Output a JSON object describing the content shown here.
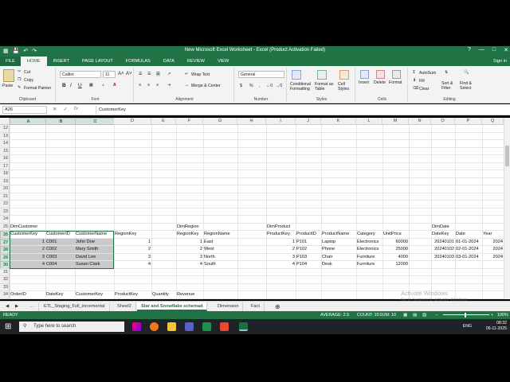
{
  "window": {
    "title": "New Microsoft Excel Worksheet - Excel (Product Activation Failed)",
    "minimize": "—",
    "maximize": "□",
    "close": "✕",
    "restore_ribbon": "?"
  },
  "tabs": [
    {
      "label": "FILE"
    },
    {
      "label": "HOME"
    },
    {
      "label": "INSERT"
    },
    {
      "label": "PAGE LAYOUT"
    },
    {
      "label": "FORMULAS"
    },
    {
      "label": "DATA"
    },
    {
      "label": "REVIEW"
    },
    {
      "label": "VIEW"
    }
  ],
  "sign_in": "Sign in",
  "ribbon": {
    "clipboard": {
      "paste": "Paste",
      "cut": "Cut",
      "copy": "Copy",
      "painter": "Format Painter",
      "label": "Clipboard"
    },
    "font": {
      "name": "Calibri",
      "size": "11",
      "label": "Font",
      "bold": "B",
      "italic": "I",
      "underline": "U"
    },
    "alignment": {
      "wrap": "Wrap Text",
      "merge": "Merge & Center",
      "label": "Alignment"
    },
    "number": {
      "format": "General",
      "label": "Number",
      "currency": "$",
      "percent": "%"
    },
    "styles": {
      "conditional": "Conditional Formatting",
      "table": "Format as Table",
      "cell": "Cell Styles",
      "label": "Styles"
    },
    "cells": {
      "insert": "Insert",
      "delete": "Delete",
      "format": "Format",
      "label": "Cells"
    },
    "editing": {
      "autosum": "AutoSum",
      "fill": "Fill",
      "clear": "Clear",
      "sort": "Sort & Filter",
      "find": "Find & Select",
      "label": "Editing"
    }
  },
  "formula_bar": {
    "name_box": "A26",
    "formula": "CustomerKey"
  },
  "columns": [
    "A",
    "B",
    "C",
    "D",
    "E",
    "F",
    "G",
    "H",
    "I",
    "J",
    "K",
    "L",
    "M",
    "N",
    "O",
    "P",
    "Q"
  ],
  "rows": [
    "12",
    "13",
    "14",
    "15",
    "16",
    "17",
    "18",
    "19",
    "20",
    "21",
    "22",
    "23",
    "24",
    "25",
    "26",
    "27",
    "28",
    "29",
    "30",
    "31",
    "32",
    "33",
    "34",
    "35"
  ],
  "cells": {
    "r25": {
      "A": "DimCustomer",
      "F": "DimRegion",
      "I": "DimProduct",
      "O": "DimDate"
    },
    "r26": {
      "A": "CustomerKey",
      "B": "CustomerID",
      "C": "CustomerName",
      "D": "RegionKey",
      "F": "RegionKey",
      "G": "RegionName",
      "I": "ProductKey",
      "J": "ProductID",
      "K": "ProductName",
      "L": "Category",
      "M": "UnitPrice",
      "O": "DateKey",
      "P": "Date",
      "Q": "Year",
      "R": "Mo"
    },
    "r27": {
      "A": "1",
      "B": "C001",
      "C": "John Doe",
      "D": "1",
      "F": "1",
      "G": "East",
      "I": "1",
      "J": "P101",
      "K": "Laptop",
      "L": "Electronics",
      "M": "60000",
      "O": "20240101",
      "P": "01-01-2024",
      "Q": "2024"
    },
    "r28": {
      "A": "2",
      "B": "C002",
      "C": "Mary Smith",
      "D": "2",
      "F": "2",
      "G": "West",
      "I": "2",
      "J": "P102",
      "K": "Phone",
      "L": "Electronics",
      "M": "25000",
      "O": "20240102",
      "P": "02-01-2024",
      "Q": "2024"
    },
    "r29": {
      "A": "3",
      "B": "C003",
      "C": "David Lee",
      "D": "3",
      "F": "3",
      "G": "North",
      "I": "3",
      "J": "P103",
      "K": "Chair",
      "L": "Furniture",
      "M": "4000",
      "O": "20240103",
      "P": "03-01-2024",
      "Q": "2024"
    },
    "r30": {
      "A": "4",
      "B": "C004",
      "C": "Susan Clark",
      "D": "4",
      "F": "4",
      "G": "South",
      "I": "4",
      "J": "P104",
      "K": "Desk",
      "L": "Furniture",
      "M": "12000"
    },
    "r34": {
      "A": "OrderID",
      "B": "DateKey",
      "C": "CustomerKey",
      "D": "ProductKey",
      "E": "Quantity",
      "F": "Revenue"
    },
    "r35": {
      "A": "1001",
      "B": "20240101",
      "C": "1",
      "D": "1",
      "E": "1",
      "F": "60000"
    }
  },
  "sheets": [
    "ETL_Staging_Full_incremental",
    "Sheet2",
    "Star and Snowflake schemad",
    "Dimension",
    "Fact"
  ],
  "active_sheet": "Star and Snowflake schemad",
  "status": {
    "ready": "READY",
    "average": "AVERAGE: 2.5",
    "count": "COUNT: 15",
    "sum": "SUM: 10",
    "zoom": "100%"
  },
  "taskbar": {
    "search_placeholder": "Type here to search",
    "time": "08:32",
    "date": "06-11-2025",
    "lang": "ENG"
  },
  "watermark": {
    "line1": "Activate Windows",
    "line2": "Go to Settings to activate Windows."
  },
  "colors": {
    "excel_green": "#217346",
    "selection_gray": "#c9c9c9"
  }
}
